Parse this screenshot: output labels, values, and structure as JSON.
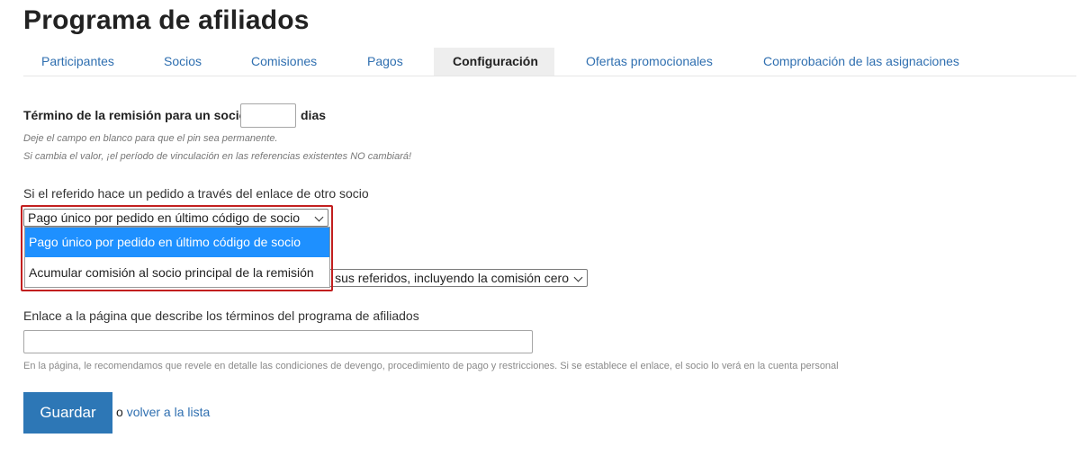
{
  "page_title": "Programa de afiliados",
  "tabs": [
    {
      "label": "Participantes"
    },
    {
      "label": "Socios"
    },
    {
      "label": "Comisiones"
    },
    {
      "label": "Pagos"
    },
    {
      "label": "Configuración",
      "active": true
    },
    {
      "label": "Ofertas promocionales"
    },
    {
      "label": "Comprobación de las asignaciones"
    }
  ],
  "referral_term": {
    "label": "Término de la remisión para un socio",
    "value": "",
    "unit": "dias",
    "hint1": "Deje el campo en blanco para que el pin sea permanente.",
    "hint2": "Si cambia el valor, ¡el período de vinculación en las referencias existentes NO cambiará!"
  },
  "other_partner_order": {
    "label": "Si el referido hace un pedido a través del enlace de otro socio",
    "selected": "Pago único por pedido en último código de socio",
    "options": [
      "Pago único por pedido en último código de socio",
      "Acumular comisión al socio principal de la remisión"
    ]
  },
  "hidden_select": {
    "visible_text": "sus referidos, incluyendo la comisión cero"
  },
  "terms_link": {
    "label": "Enlace a la página que describe los términos del programa de afiliados",
    "value": "",
    "hint": "En la página, le recomendamos que revele en detalle las condiciones de devengo, procedimiento de pago y restricciones. Si se establece el enlace, el socio lo verá en la cuenta personal"
  },
  "actions": {
    "save_label": "Guardar",
    "or_text": "o",
    "back_link": "volver a la lista"
  },
  "colors": {
    "link": "#2f6fb0",
    "button": "#2d77b6",
    "selected_option": "#1e90ff",
    "highlight_border": "#c21f1f"
  }
}
